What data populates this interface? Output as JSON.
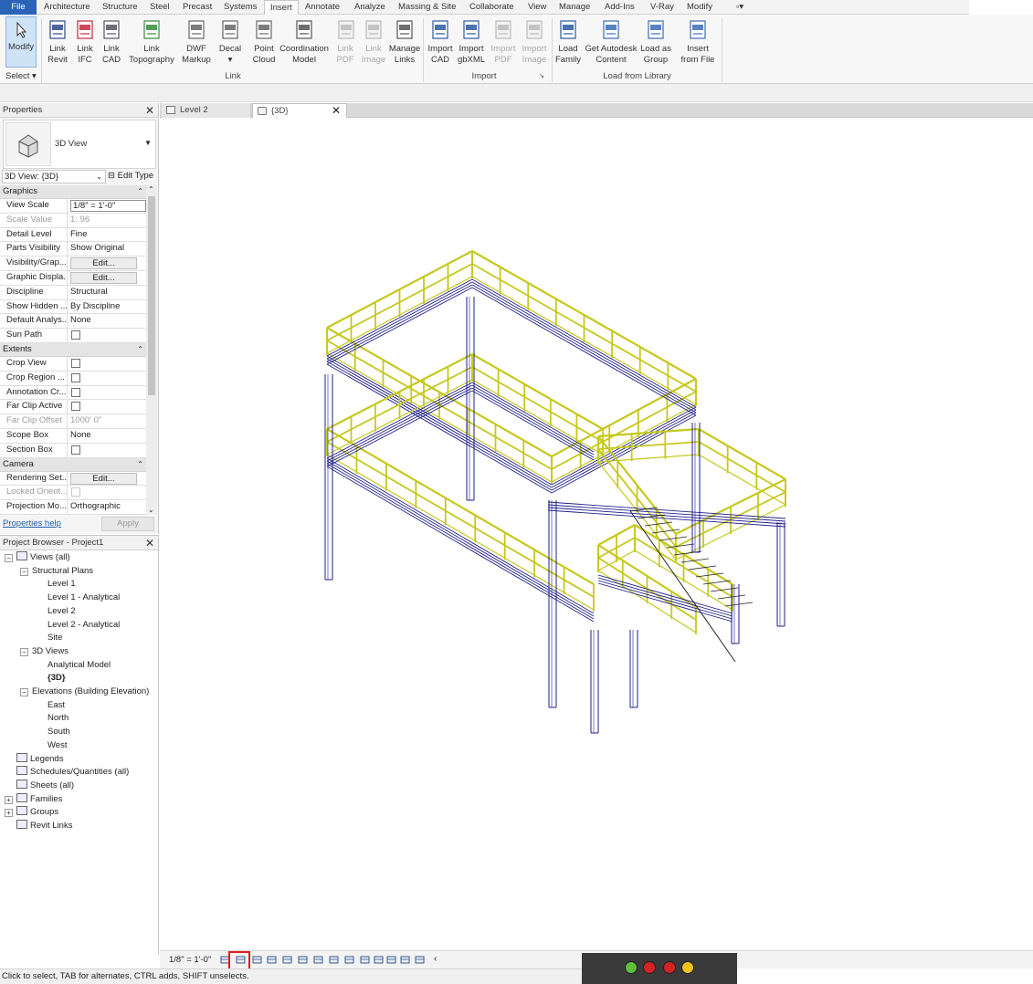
{
  "menu": {
    "file": "File",
    "tabs": [
      "Architecture",
      "Structure",
      "Steel",
      "Precast",
      "Systems",
      "Insert",
      "Annotate",
      "Analyze",
      "Massing & Site",
      "Collaborate",
      "View",
      "Manage",
      "Add-Ins",
      "V-Ray",
      "Modify"
    ]
  },
  "ribbon": {
    "modify": "Modify",
    "select": "Select",
    "buttons": [
      {
        "l1": "Link",
        "l2": "Revit"
      },
      {
        "l1": "Link",
        "l2": "IFC"
      },
      {
        "l1": "Link",
        "l2": "CAD"
      },
      {
        "l1": "Link",
        "l2": "Topography"
      },
      {
        "l1": "DWF",
        "l2": "Markup"
      },
      {
        "l1": "Decal",
        "l2": ""
      },
      {
        "l1": "Point",
        "l2": "Cloud"
      },
      {
        "l1": "Coordination",
        "l2": "Model"
      },
      {
        "l1": "Link",
        "l2": "PDF"
      },
      {
        "l1": "Link",
        "l2": "Image"
      },
      {
        "l1": "Manage",
        "l2": "Links"
      },
      {
        "l1": "Import",
        "l2": "CAD"
      },
      {
        "l1": "Import",
        "l2": "gbXML"
      },
      {
        "l1": "Import",
        "l2": "PDF"
      },
      {
        "l1": "Import",
        "l2": "Image"
      },
      {
        "l1": "Load",
        "l2": "Family"
      },
      {
        "l1": "Get Autodesk",
        "l2": "Content"
      },
      {
        "l1": "Load as",
        "l2": "Group"
      },
      {
        "l1": "Insert",
        "l2": "from File"
      }
    ],
    "groups": {
      "link": "Link",
      "import": "Import",
      "load": "Load from Library"
    },
    "icon_names": [
      "revit-link-icon",
      "ifc-icon",
      "cad-icon",
      "topography-icon",
      "dwf-icon",
      "decal-icon",
      "point-cloud-icon",
      "coordination-model-icon",
      "pdf-icon",
      "image-icon",
      "manage-links-icon",
      "import-cad-icon",
      "gbxml-icon",
      "import-pdf-icon",
      "import-image-icon",
      "load-family-icon",
      "autodesk-content-icon",
      "load-group-icon",
      "insert-file-icon"
    ]
  },
  "properties": {
    "title": "Properties",
    "type_name": "3D View",
    "instance": "3D View: {3D}",
    "edit_type": "Edit Type",
    "sections": {
      "graphics": "Graphics",
      "extents": "Extents",
      "camera": "Camera"
    },
    "graphics_rows": [
      {
        "k": "View Scale",
        "v": "1/8\" = 1'-0\""
      },
      {
        "k": "Scale Value",
        "v": "1:  96"
      },
      {
        "k": "Detail Level",
        "v": "Fine"
      },
      {
        "k": "Parts Visibility",
        "v": "Show Original"
      },
      {
        "k": "Visibility/Grap...",
        "v": "Edit..."
      },
      {
        "k": "Graphic Displa...",
        "v": "Edit..."
      },
      {
        "k": "Discipline",
        "v": "Structural"
      },
      {
        "k": "Show Hidden ...",
        "v": "By Discipline"
      },
      {
        "k": "Default Analys...",
        "v": "None"
      },
      {
        "k": "Sun Path",
        "v": ""
      }
    ],
    "extents_rows": [
      {
        "k": "Crop View",
        "v": ""
      },
      {
        "k": "Crop Region ...",
        "v": ""
      },
      {
        "k": "Annotation Cr...",
        "v": ""
      },
      {
        "k": "Far Clip Active",
        "v": ""
      },
      {
        "k": "Far Clip Offset",
        "v": "1000'  0\""
      },
      {
        "k": "Scope Box",
        "v": "None"
      },
      {
        "k": "Section Box",
        "v": ""
      }
    ],
    "camera_rows": [
      {
        "k": "Rendering Set...",
        "v": "Edit..."
      },
      {
        "k": "Locked Orient...",
        "v": ""
      },
      {
        "k": "Projection Mo...",
        "v": "Orthographic"
      }
    ],
    "help": "Properties help",
    "apply": "Apply"
  },
  "browser": {
    "title": "Project Browser - Project1",
    "views_all": "Views (all)",
    "structural_plans": "Structural Plans",
    "plans": [
      "Level 1",
      "Level 1 - Analytical",
      "Level 2",
      "Level 2 - Analytical",
      "Site"
    ],
    "views_3d": "3D Views",
    "views3d_items": [
      "Analytical Model",
      "{3D}"
    ],
    "elevations": "Elevations (Building Elevation)",
    "elev_items": [
      "East",
      "North",
      "South",
      "West"
    ],
    "roots": [
      "Legends",
      "Schedules/Quantities (all)",
      "Sheets (all)",
      "Families",
      "Groups",
      "Revit Links"
    ]
  },
  "view_tabs": {
    "tab1": "Level 2",
    "tab2": "{3D}"
  },
  "vcb": {
    "scale": "1/8\" = 1'-0\""
  },
  "status": "Click to select, TAB for alternates, CTRL adds, SHIFT unselects.",
  "colors": {
    "railing": "#c6c81e",
    "structure": "#1f1f8c",
    "highlight": "#e21b1b",
    "file_tab": "#2a63b8"
  }
}
